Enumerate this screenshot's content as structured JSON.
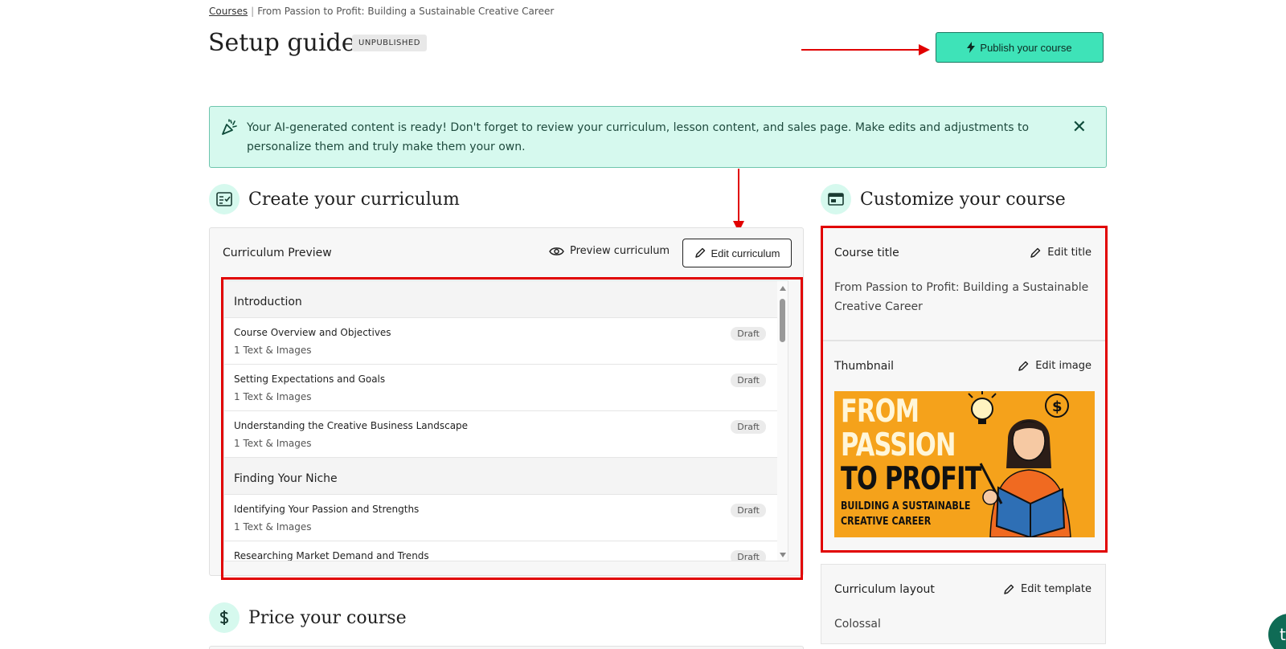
{
  "breadcrumb": {
    "link": "Courses",
    "separator": "|",
    "current": "From Passion to Profit: Building a Sustainable Creative Career"
  },
  "header": {
    "title": "Setup guide",
    "status": "UNPUBLISHED",
    "publish_label": "Publish your course"
  },
  "banner": {
    "message": "Your AI-generated content is ready! Don't forget to review your curriculum, lesson content, and sales page. Make edits and adjustments to personalize them and truly make them your own.",
    "close": "✕"
  },
  "curriculum": {
    "section_title": "Create your curriculum",
    "panel_label": "Curriculum Preview",
    "preview_label": "Preview curriculum",
    "edit_label": "Edit curriculum",
    "groups": [
      {
        "title": "Introduction",
        "lessons": [
          {
            "title": "Course Overview and Objectives",
            "meta": "1 Text & Images",
            "status": "Draft"
          },
          {
            "title": "Setting Expectations and Goals",
            "meta": "1 Text & Images",
            "status": "Draft"
          },
          {
            "title": "Understanding the Creative Business Landscape",
            "meta": "1 Text & Images",
            "status": "Draft"
          }
        ]
      },
      {
        "title": "Finding Your Niche",
        "lessons": [
          {
            "title": "Identifying Your Passion and Strengths",
            "meta": "1 Text & Images",
            "status": "Draft"
          },
          {
            "title": "Researching Market Demand and Trends",
            "meta": "",
            "status": "Draft"
          }
        ]
      }
    ]
  },
  "customize": {
    "section_title": "Customize your course",
    "course_title_label": "Course title",
    "edit_title_label": "Edit title",
    "course_title_value": "From Passion to Profit: Building a Sustainable Creative Career",
    "thumbnail_label": "Thumbnail",
    "edit_image_label": "Edit image",
    "thumbnail_text": {
      "line1": "FROM",
      "line2": "PASSION",
      "line3": "TO PROFIT",
      "line4": "BUILDING A SUSTAINABLE",
      "line5": "CREATIVE CAREER"
    },
    "layout_label": "Curriculum layout",
    "edit_template_label": "Edit template",
    "layout_value": "Colossal"
  },
  "price": {
    "section_title": "Price your course"
  },
  "chat": {
    "glyph": "t"
  },
  "icons": {
    "publish": "lightning-icon",
    "banner": "party-popper-icon",
    "close": "close-icon",
    "curriculum": "checklist-icon",
    "customize": "layout-icon",
    "price": "dollar-icon",
    "preview": "eye-icon",
    "edit": "pencil-icon"
  },
  "colors": {
    "accent": "#3ee3b8",
    "banner_bg": "#d6f9ee",
    "annotation_red": "#e10000"
  }
}
